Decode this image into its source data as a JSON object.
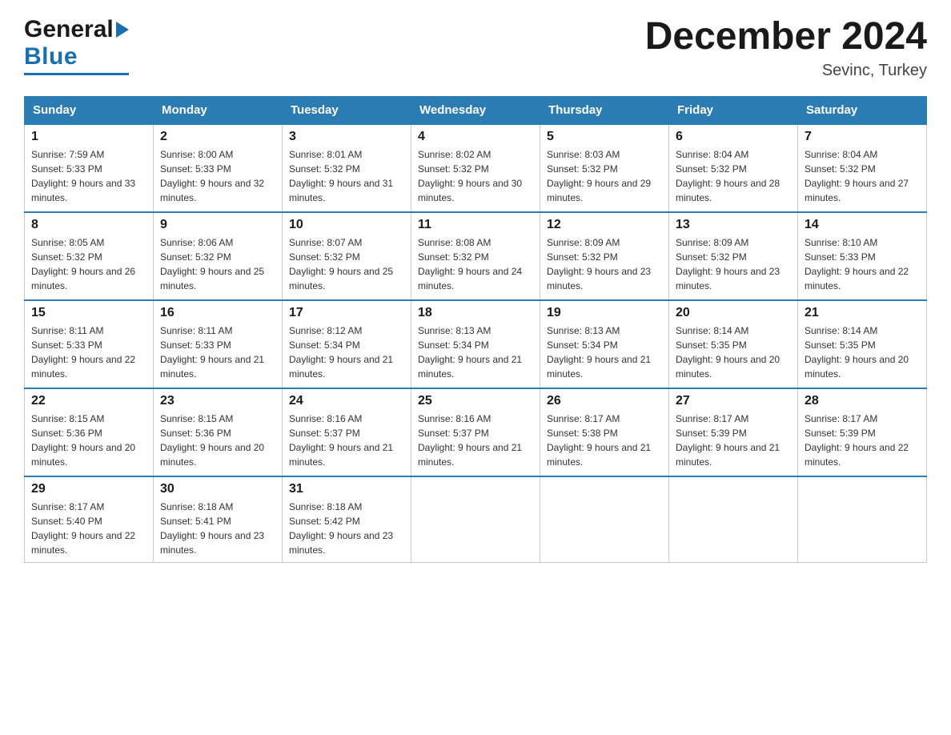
{
  "header": {
    "logo_general": "General",
    "logo_blue": "Blue",
    "title": "December 2024",
    "location": "Sevinc, Turkey"
  },
  "calendar": {
    "days_of_week": [
      "Sunday",
      "Monday",
      "Tuesday",
      "Wednesday",
      "Thursday",
      "Friday",
      "Saturday"
    ],
    "weeks": [
      [
        {
          "day": "1",
          "sunrise": "Sunrise: 7:59 AM",
          "sunset": "Sunset: 5:33 PM",
          "daylight": "Daylight: 9 hours and 33 minutes."
        },
        {
          "day": "2",
          "sunrise": "Sunrise: 8:00 AM",
          "sunset": "Sunset: 5:33 PM",
          "daylight": "Daylight: 9 hours and 32 minutes."
        },
        {
          "day": "3",
          "sunrise": "Sunrise: 8:01 AM",
          "sunset": "Sunset: 5:32 PM",
          "daylight": "Daylight: 9 hours and 31 minutes."
        },
        {
          "day": "4",
          "sunrise": "Sunrise: 8:02 AM",
          "sunset": "Sunset: 5:32 PM",
          "daylight": "Daylight: 9 hours and 30 minutes."
        },
        {
          "day": "5",
          "sunrise": "Sunrise: 8:03 AM",
          "sunset": "Sunset: 5:32 PM",
          "daylight": "Daylight: 9 hours and 29 minutes."
        },
        {
          "day": "6",
          "sunrise": "Sunrise: 8:04 AM",
          "sunset": "Sunset: 5:32 PM",
          "daylight": "Daylight: 9 hours and 28 minutes."
        },
        {
          "day": "7",
          "sunrise": "Sunrise: 8:04 AM",
          "sunset": "Sunset: 5:32 PM",
          "daylight": "Daylight: 9 hours and 27 minutes."
        }
      ],
      [
        {
          "day": "8",
          "sunrise": "Sunrise: 8:05 AM",
          "sunset": "Sunset: 5:32 PM",
          "daylight": "Daylight: 9 hours and 26 minutes."
        },
        {
          "day": "9",
          "sunrise": "Sunrise: 8:06 AM",
          "sunset": "Sunset: 5:32 PM",
          "daylight": "Daylight: 9 hours and 25 minutes."
        },
        {
          "day": "10",
          "sunrise": "Sunrise: 8:07 AM",
          "sunset": "Sunset: 5:32 PM",
          "daylight": "Daylight: 9 hours and 25 minutes."
        },
        {
          "day": "11",
          "sunrise": "Sunrise: 8:08 AM",
          "sunset": "Sunset: 5:32 PM",
          "daylight": "Daylight: 9 hours and 24 minutes."
        },
        {
          "day": "12",
          "sunrise": "Sunrise: 8:09 AM",
          "sunset": "Sunset: 5:32 PM",
          "daylight": "Daylight: 9 hours and 23 minutes."
        },
        {
          "day": "13",
          "sunrise": "Sunrise: 8:09 AM",
          "sunset": "Sunset: 5:32 PM",
          "daylight": "Daylight: 9 hours and 23 minutes."
        },
        {
          "day": "14",
          "sunrise": "Sunrise: 8:10 AM",
          "sunset": "Sunset: 5:33 PM",
          "daylight": "Daylight: 9 hours and 22 minutes."
        }
      ],
      [
        {
          "day": "15",
          "sunrise": "Sunrise: 8:11 AM",
          "sunset": "Sunset: 5:33 PM",
          "daylight": "Daylight: 9 hours and 22 minutes."
        },
        {
          "day": "16",
          "sunrise": "Sunrise: 8:11 AM",
          "sunset": "Sunset: 5:33 PM",
          "daylight": "Daylight: 9 hours and 21 minutes."
        },
        {
          "day": "17",
          "sunrise": "Sunrise: 8:12 AM",
          "sunset": "Sunset: 5:34 PM",
          "daylight": "Daylight: 9 hours and 21 minutes."
        },
        {
          "day": "18",
          "sunrise": "Sunrise: 8:13 AM",
          "sunset": "Sunset: 5:34 PM",
          "daylight": "Daylight: 9 hours and 21 minutes."
        },
        {
          "day": "19",
          "sunrise": "Sunrise: 8:13 AM",
          "sunset": "Sunset: 5:34 PM",
          "daylight": "Daylight: 9 hours and 21 minutes."
        },
        {
          "day": "20",
          "sunrise": "Sunrise: 8:14 AM",
          "sunset": "Sunset: 5:35 PM",
          "daylight": "Daylight: 9 hours and 20 minutes."
        },
        {
          "day": "21",
          "sunrise": "Sunrise: 8:14 AM",
          "sunset": "Sunset: 5:35 PM",
          "daylight": "Daylight: 9 hours and 20 minutes."
        }
      ],
      [
        {
          "day": "22",
          "sunrise": "Sunrise: 8:15 AM",
          "sunset": "Sunset: 5:36 PM",
          "daylight": "Daylight: 9 hours and 20 minutes."
        },
        {
          "day": "23",
          "sunrise": "Sunrise: 8:15 AM",
          "sunset": "Sunset: 5:36 PM",
          "daylight": "Daylight: 9 hours and 20 minutes."
        },
        {
          "day": "24",
          "sunrise": "Sunrise: 8:16 AM",
          "sunset": "Sunset: 5:37 PM",
          "daylight": "Daylight: 9 hours and 21 minutes."
        },
        {
          "day": "25",
          "sunrise": "Sunrise: 8:16 AM",
          "sunset": "Sunset: 5:37 PM",
          "daylight": "Daylight: 9 hours and 21 minutes."
        },
        {
          "day": "26",
          "sunrise": "Sunrise: 8:17 AM",
          "sunset": "Sunset: 5:38 PM",
          "daylight": "Daylight: 9 hours and 21 minutes."
        },
        {
          "day": "27",
          "sunrise": "Sunrise: 8:17 AM",
          "sunset": "Sunset: 5:39 PM",
          "daylight": "Daylight: 9 hours and 21 minutes."
        },
        {
          "day": "28",
          "sunrise": "Sunrise: 8:17 AM",
          "sunset": "Sunset: 5:39 PM",
          "daylight": "Daylight: 9 hours and 22 minutes."
        }
      ],
      [
        {
          "day": "29",
          "sunrise": "Sunrise: 8:17 AM",
          "sunset": "Sunset: 5:40 PM",
          "daylight": "Daylight: 9 hours and 22 minutes."
        },
        {
          "day": "30",
          "sunrise": "Sunrise: 8:18 AM",
          "sunset": "Sunset: 5:41 PM",
          "daylight": "Daylight: 9 hours and 23 minutes."
        },
        {
          "day": "31",
          "sunrise": "Sunrise: 8:18 AM",
          "sunset": "Sunset: 5:42 PM",
          "daylight": "Daylight: 9 hours and 23 minutes."
        },
        null,
        null,
        null,
        null
      ]
    ]
  }
}
